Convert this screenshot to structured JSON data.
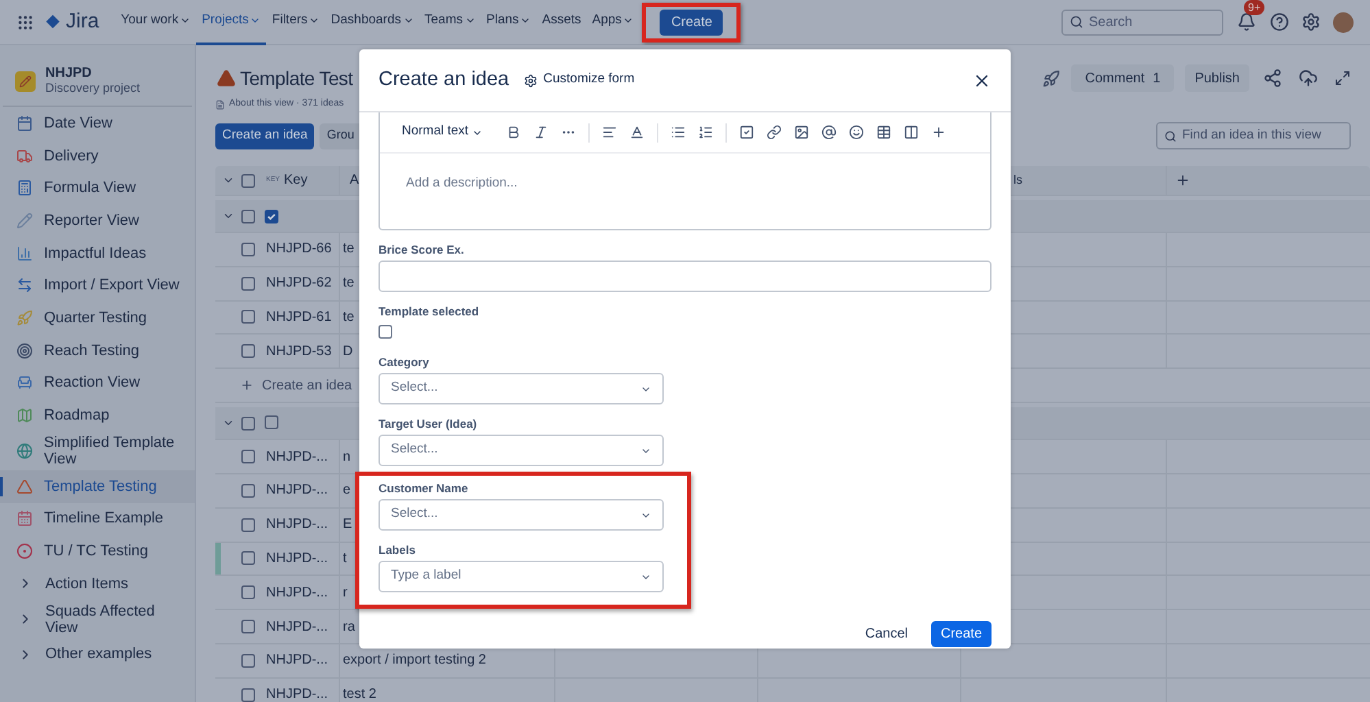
{
  "nav": {
    "logo": "Jira",
    "items": [
      {
        "label": "Your work",
        "dropdown": true,
        "selected": false
      },
      {
        "label": "Projects",
        "dropdown": true,
        "selected": true
      },
      {
        "label": "Filters",
        "dropdown": true,
        "selected": false
      },
      {
        "label": "Dashboards",
        "dropdown": true,
        "selected": false
      },
      {
        "label": "Teams",
        "dropdown": true,
        "selected": false
      },
      {
        "label": "Plans",
        "dropdown": true,
        "selected": false
      },
      {
        "label": "Assets",
        "dropdown": false,
        "selected": false
      },
      {
        "label": "Apps",
        "dropdown": true,
        "selected": false
      }
    ],
    "create": {
      "label": "Create",
      "highlighted": true
    },
    "search": {
      "placeholder": "Search"
    },
    "notifications_badge": "9+"
  },
  "sidebar": {
    "project": {
      "name": "NHJPD",
      "type": "Discovery project"
    },
    "items": [
      {
        "kind": "view",
        "label": "Date View",
        "selected": false
      },
      {
        "kind": "view",
        "label": "Delivery",
        "selected": false
      },
      {
        "kind": "view",
        "label": "Formula View",
        "selected": false
      },
      {
        "kind": "view",
        "label": "Reporter View",
        "selected": false
      },
      {
        "kind": "view",
        "label": "Impactful Ideas",
        "selected": false
      },
      {
        "kind": "view",
        "label": "Import / Export View",
        "selected": false
      },
      {
        "kind": "view",
        "label": "Quarter Testing",
        "selected": false
      },
      {
        "kind": "view",
        "label": "Reach Testing",
        "selected": false
      },
      {
        "kind": "view",
        "label": "Reaction View",
        "selected": false
      },
      {
        "kind": "view",
        "label": "Roadmap",
        "selected": false
      },
      {
        "kind": "view",
        "label": "Simplified Template View",
        "selected": false
      },
      {
        "kind": "view",
        "label": "Template Testing",
        "selected": true
      },
      {
        "kind": "view",
        "label": "Timeline Example",
        "selected": false
      },
      {
        "kind": "view",
        "label": "TU / TC Testing",
        "selected": false
      },
      {
        "kind": "folder",
        "label": "Action Items",
        "selected": false
      },
      {
        "kind": "folder",
        "label": "Squads Affected View",
        "selected": false
      },
      {
        "kind": "folder",
        "label": "Other examples",
        "selected": false
      }
    ]
  },
  "view": {
    "title": "Template Test",
    "about": "About this view · 371 ideas",
    "create_button": "Create an idea",
    "group_button": "Grou",
    "actions": {
      "comment": "Comment",
      "comment_count": "1",
      "publish": "Publish"
    },
    "search": {
      "placeholder": "Find an idea in this view"
    }
  },
  "table": {
    "select_all_checked": false,
    "columns": {
      "key_tag": "KEY",
      "key": "Key",
      "column_2": "A",
      "column_5": "ls"
    },
    "groups": [
      {
        "checked": [
          false,
          true
        ],
        "rows": [
          {
            "key": "NHJPD-66",
            "column_2": "te",
            "checked": false,
            "marked": false
          },
          {
            "key": "NHJPD-62",
            "column_2": "te",
            "checked": false,
            "marked": false
          },
          {
            "key": "NHJPD-61",
            "column_2": "te",
            "checked": false,
            "marked": false
          },
          {
            "key": "NHJPD-53",
            "column_2": "D",
            "checked": false,
            "marked": false
          }
        ],
        "create_label": "Create an idea"
      },
      {
        "checked": [
          false,
          false
        ],
        "rows": [
          {
            "key": "NHJPD-...",
            "column_2": "n",
            "checked": false,
            "marked": false
          },
          {
            "key": "NHJPD-...",
            "column_2": "e",
            "checked": false,
            "marked": false
          },
          {
            "key": "NHJPD-...",
            "column_2": "E",
            "checked": false,
            "marked": false
          },
          {
            "key": "NHJPD-...",
            "column_2": "t",
            "checked": false,
            "marked": true
          },
          {
            "key": "NHJPD-...",
            "column_2": "r",
            "checked": false,
            "marked": false
          },
          {
            "key": "NHJPD-...",
            "column_2": "ra",
            "checked": false,
            "marked": false
          },
          {
            "key": "NHJPD-...",
            "column_2": "export / import testing 2",
            "checked": false,
            "marked": false
          },
          {
            "key": "NHJPD-...",
            "column_2": "test 2",
            "checked": false,
            "marked": false
          }
        ]
      }
    ]
  },
  "modal": {
    "title": "Create an idea",
    "customize": "Customize form",
    "fields": [
      {
        "kind": "editor",
        "block_style": "Normal text",
        "placeholder": "Add a description...",
        "highlighted": false
      },
      {
        "kind": "text",
        "label": "Brice Score Ex.",
        "highlighted": false
      },
      {
        "kind": "checkbox",
        "label": "Template selected",
        "checked": false,
        "highlighted": false
      },
      {
        "kind": "select",
        "label": "Category",
        "placeholder": "Select...",
        "highlighted": false
      },
      {
        "kind": "select",
        "label": "Target User (Idea)",
        "placeholder": "Select...",
        "highlighted": false
      },
      {
        "kind": "select",
        "label": "Customer Name",
        "placeholder": "Select...",
        "highlighted": true
      },
      {
        "kind": "select",
        "label": "Labels",
        "placeholder": "Type a label",
        "highlighted": true
      }
    ],
    "cancel": "Cancel",
    "submit": "Create"
  }
}
